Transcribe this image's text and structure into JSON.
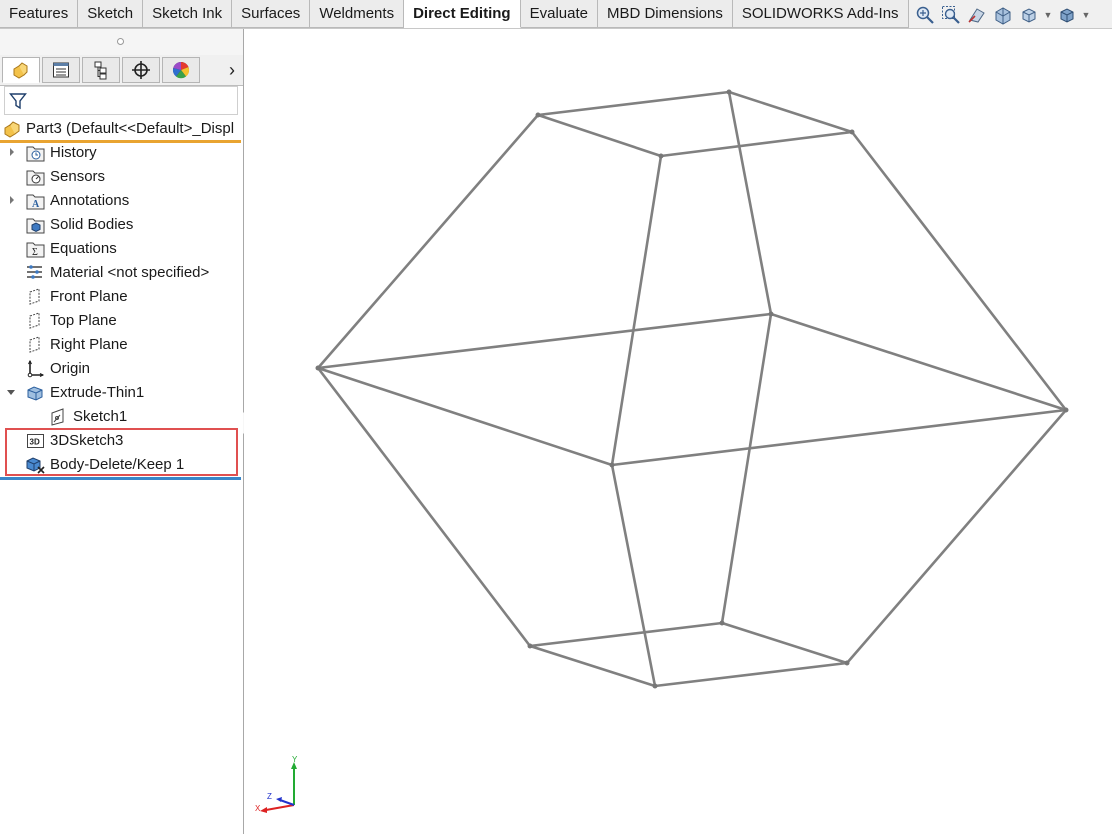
{
  "command_tabs": [
    {
      "label": "Features",
      "active": false
    },
    {
      "label": "Sketch",
      "active": false
    },
    {
      "label": "Sketch Ink",
      "active": false
    },
    {
      "label": "Surfaces",
      "active": false
    },
    {
      "label": "Weldments",
      "active": false
    },
    {
      "label": "Direct Editing",
      "active": true
    },
    {
      "label": "Evaluate",
      "active": false
    },
    {
      "label": "MBD Dimensions",
      "active": false
    },
    {
      "label": "SOLIDWORKS Add-Ins",
      "active": false
    }
  ],
  "view_toolbar": [
    {
      "icon": "zoom-to-fit-icon"
    },
    {
      "icon": "zoom-to-area-icon"
    },
    {
      "icon": "previous-view-icon"
    },
    {
      "icon": "section-view-icon"
    },
    {
      "icon": "view-orientation-icon"
    },
    {
      "icon": "display-style-icon"
    }
  ],
  "panel_tabs": [
    {
      "icon": "feature-manager-icon",
      "active": true
    },
    {
      "icon": "property-manager-icon",
      "active": false
    },
    {
      "icon": "configuration-manager-icon",
      "active": false
    },
    {
      "icon": "dimxpert-manager-icon",
      "active": false
    },
    {
      "icon": "display-manager-icon",
      "active": false
    }
  ],
  "feature_tree": {
    "root_label": "Part3  (Default<<Default>_Displ",
    "items": [
      {
        "label": "History",
        "icon": "history-folder-icon",
        "expandable": true,
        "expanded": false,
        "indent": 0
      },
      {
        "label": "Sensors",
        "icon": "sensors-icon",
        "expandable": false,
        "indent": 0
      },
      {
        "label": "Annotations",
        "icon": "annotations-icon",
        "expandable": true,
        "expanded": false,
        "indent": 0
      },
      {
        "label": "Solid Bodies",
        "icon": "solid-bodies-icon",
        "expandable": false,
        "indent": 0
      },
      {
        "label": "Equations",
        "icon": "equations-icon",
        "expandable": false,
        "indent": 0
      },
      {
        "label": "Material <not specified>",
        "icon": "material-icon",
        "expandable": false,
        "indent": 0
      },
      {
        "label": "Front Plane",
        "icon": "plane-icon",
        "expandable": false,
        "indent": 0
      },
      {
        "label": "Top Plane",
        "icon": "plane-icon",
        "expandable": false,
        "indent": 0
      },
      {
        "label": "Right Plane",
        "icon": "plane-icon",
        "expandable": false,
        "indent": 0
      },
      {
        "label": "Origin",
        "icon": "origin-icon",
        "expandable": false,
        "indent": 0
      },
      {
        "label": "Extrude-Thin1",
        "icon": "extrude-icon",
        "expandable": true,
        "expanded": true,
        "indent": 0
      },
      {
        "label": "Sketch1",
        "icon": "sketch-icon",
        "expandable": false,
        "indent": 1
      },
      {
        "label": "3DSketch3",
        "icon": "3d-sketch-icon",
        "expandable": false,
        "indent": 0
      },
      {
        "label": "Body-Delete/Keep 1",
        "icon": "body-delete-keep-icon",
        "expandable": false,
        "indent": 0
      }
    ]
  },
  "triad": {
    "x_label": "X",
    "y_label": "Y",
    "z_label": "Z"
  },
  "colors": {
    "accent_orange": "#e9a431",
    "rollback_blue": "#3a86c8",
    "highlight_red": "#e05050",
    "wireframe_gray": "#808080"
  }
}
